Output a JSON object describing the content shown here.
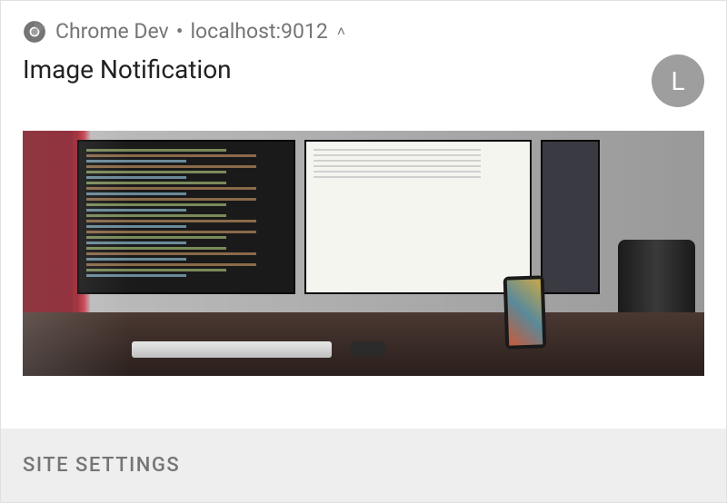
{
  "header": {
    "app_name": "Chrome Dev",
    "origin": "localhost:9012",
    "separator": "•"
  },
  "notification": {
    "title": "Image Notification",
    "avatar_letter": "L"
  },
  "actions": {
    "site_settings_label": "SITE SETTINGS"
  }
}
